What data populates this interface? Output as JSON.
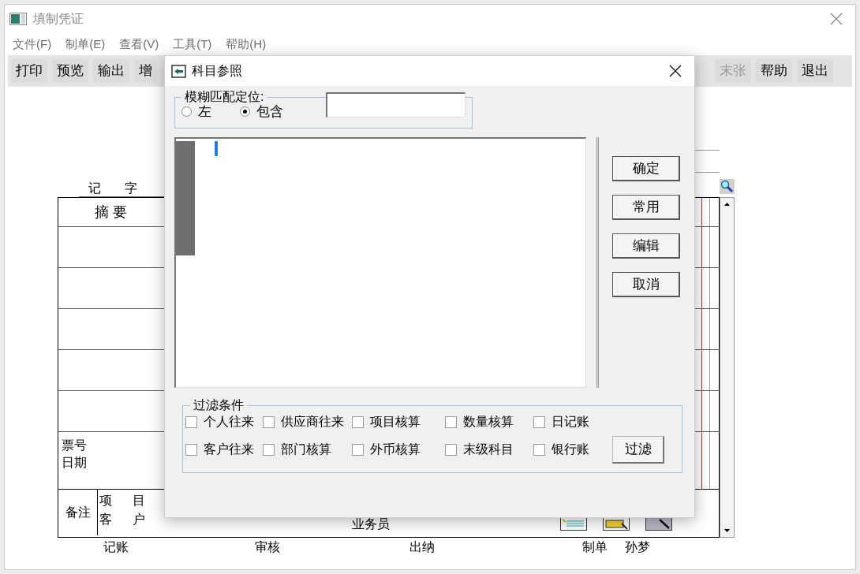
{
  "window": {
    "title": "填制凭证"
  },
  "menu": [
    "文件(F)",
    "制单(E)",
    "查看(V)",
    "工具(T)",
    "帮助(H)"
  ],
  "toolbar_left": [
    {
      "label": "打印",
      "disabled": false
    },
    {
      "label": "预览",
      "disabled": false
    },
    {
      "label": "输出",
      "disabled": false
    },
    {
      "label": "增",
      "disabled": false
    }
  ],
  "toolbar_right": [
    {
      "label": "末张",
      "disabled": true
    },
    {
      "label": "帮助",
      "disabled": false
    },
    {
      "label": "退出",
      "disabled": false
    }
  ],
  "voucher": {
    "type_chars": [
      "记",
      "字"
    ],
    "summary_header": "摘 要",
    "ticket_labels": [
      "票号",
      "日期"
    ],
    "remark": "备注",
    "remark_fields": [
      "项 目",
      "客 户"
    ],
    "salesman": "业务员",
    "signatures": [
      {
        "label": "记账"
      },
      {
        "label": "审核"
      },
      {
        "label": "出纳"
      },
      {
        "label": "制单",
        "value": "孙梦"
      }
    ]
  },
  "dialog": {
    "title": "科目参照",
    "fuzzy": {
      "legend": "模糊匹配定位:",
      "options": [
        {
          "label": "左",
          "selected": false
        },
        {
          "label": "包含",
          "selected": true
        }
      ]
    },
    "buttons": [
      "确定",
      "常用",
      "编辑",
      "取消"
    ],
    "filter": {
      "legend": "过滤条件",
      "rows": [
        [
          {
            "label": "个人往来",
            "checked": false
          },
          {
            "label": "供应商往来",
            "checked": false
          },
          {
            "label": "项目核算",
            "checked": false
          },
          {
            "label": "数量核算",
            "checked": false
          },
          {
            "label": "日记账",
            "checked": false
          }
        ],
        [
          {
            "label": "客户往来",
            "checked": false
          },
          {
            "label": "部门核算",
            "checked": false
          },
          {
            "label": "外币核算",
            "checked": false
          },
          {
            "label": "末级科目",
            "checked": false
          },
          {
            "label": "银行账",
            "checked": false
          }
        ]
      ],
      "button": "过滤"
    }
  }
}
